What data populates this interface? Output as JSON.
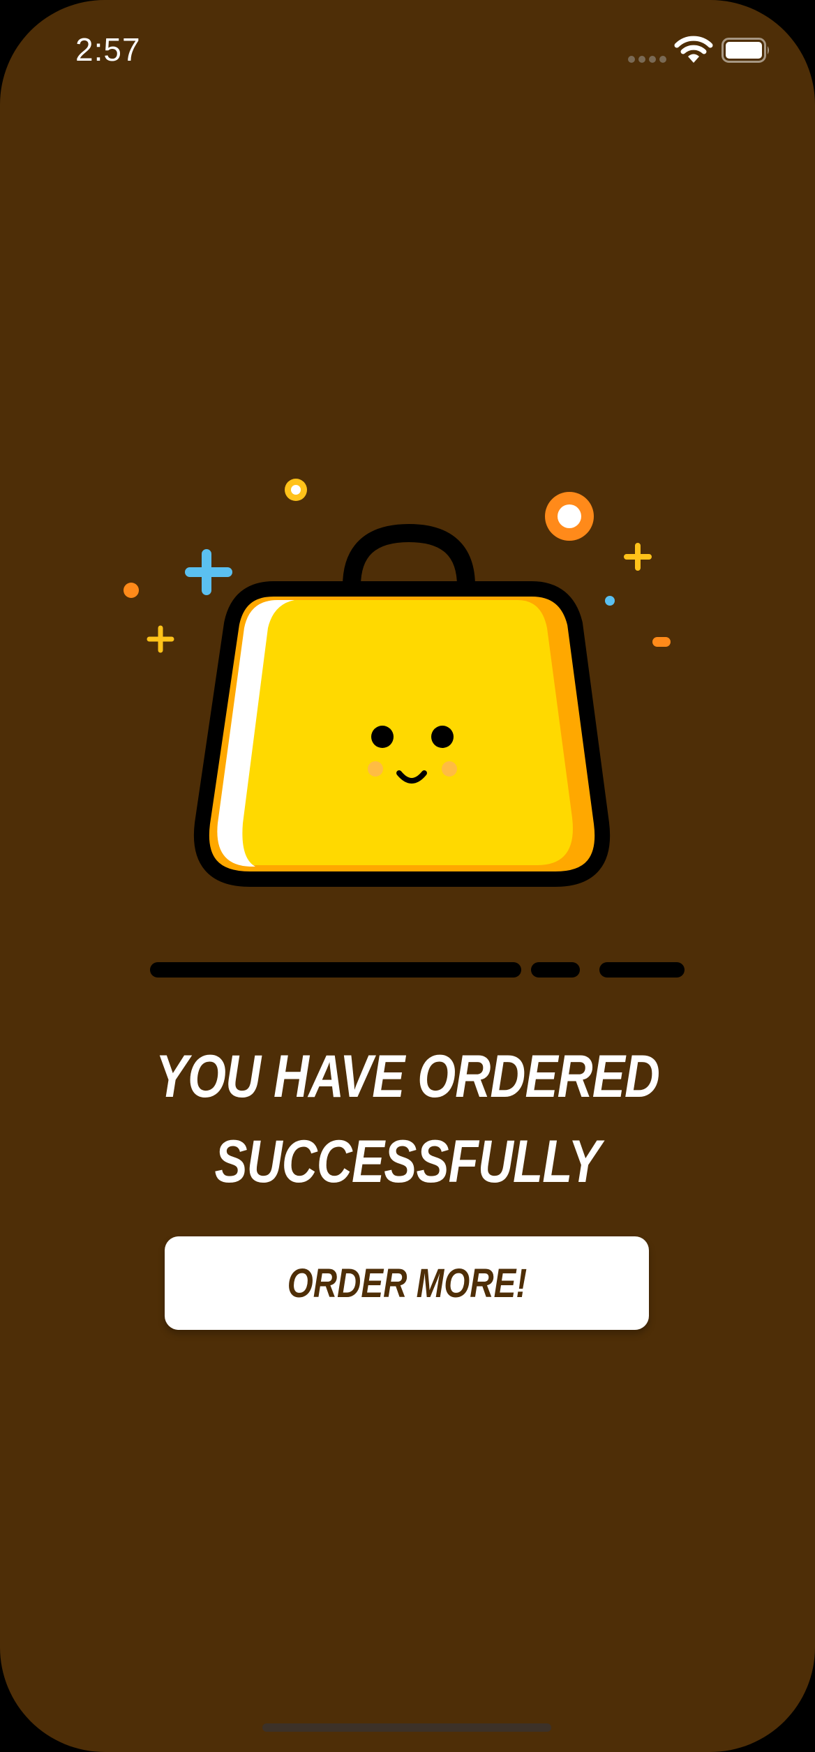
{
  "status_bar": {
    "time": "2:57",
    "icons": [
      "cellular-signal-icon",
      "wifi-icon",
      "battery-icon"
    ]
  },
  "illustration": {
    "icon": "happy-shopping-bag-icon",
    "colors": {
      "bag": "#ffd900",
      "bag_shadow": "#ffa800",
      "outline": "#000000",
      "sparkle_blue": "#5bc0f0",
      "sparkle_yellow": "#ffc21a",
      "sparkle_orange": "#ff8a1a"
    }
  },
  "message": {
    "line1": "YOU HAVE ORDERED",
    "line2": "SUCCESSFULLY"
  },
  "button": {
    "label": "ORDER MORE!"
  },
  "colors": {
    "background": "#4e2e07",
    "button_bg": "#ffffff",
    "button_text": "#4e2e07"
  }
}
